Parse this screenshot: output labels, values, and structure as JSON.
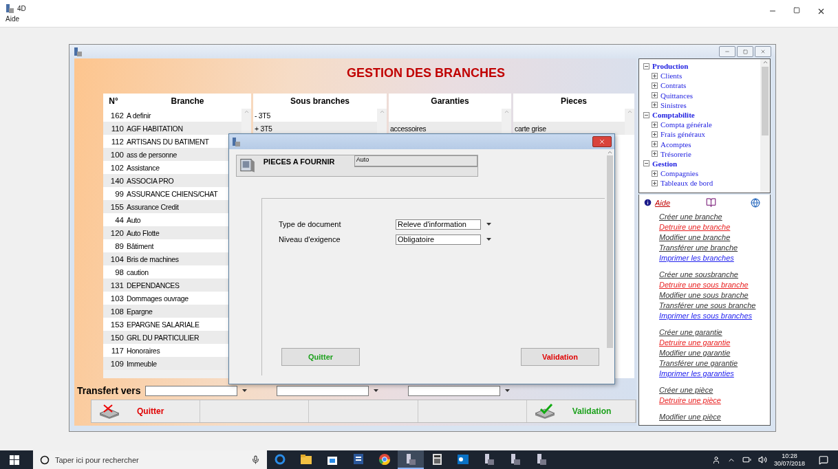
{
  "app": {
    "title": "4D",
    "menu": [
      "Aide"
    ]
  },
  "main_window": {
    "title": "GESTION DES BRANCHES",
    "columns": [
      "N°",
      "Branche",
      "Sous branches",
      "Garanties",
      "Pieces"
    ],
    "rows": [
      {
        "number": "162",
        "branche": "A definir",
        "sous_branche": "- 3T5"
      },
      {
        "number": "110",
        "branche": "AGF HABITATION",
        "sous_branche": "+ 3T5",
        "garantie": "accessoires",
        "piece": "carte grise"
      },
      {
        "number": "112",
        "branche": "ARTISANS DU BATIMENT"
      },
      {
        "number": "100",
        "branche": "ass de personne"
      },
      {
        "number": "102",
        "branche": "Assistance"
      },
      {
        "number": "140",
        "branche": "ASSOCIA PRO"
      },
      {
        "number": "99",
        "branche": "ASSURANCE CHIENS/CHAT"
      },
      {
        "number": "155",
        "branche": "Assurance Credit"
      },
      {
        "number": "44",
        "branche": "Auto"
      },
      {
        "number": "120",
        "branche": "Auto Flotte"
      },
      {
        "number": "89",
        "branche": "Bâtiment"
      },
      {
        "number": "104",
        "branche": "Bris de machines"
      },
      {
        "number": "98",
        "branche": "caution"
      },
      {
        "number": "131",
        "branche": "DEPENDANCES"
      },
      {
        "number": "103",
        "branche": "Dommages ouvrage"
      },
      {
        "number": "108",
        "branche": "Epargne"
      },
      {
        "number": "153",
        "branche": "EPARGNE SALARIALE"
      },
      {
        "number": "150",
        "branche": "GRL DU PARTICULIER"
      },
      {
        "number": "117",
        "branche": "Honoraires"
      },
      {
        "number": "109",
        "branche": "Immeuble"
      }
    ],
    "transfer_label": "Transfert vers",
    "buttons": [
      {
        "label": "Quitter",
        "kind": "quit"
      },
      {
        "label": "Validation",
        "kind": "validate"
      }
    ]
  },
  "navigator": [
    {
      "label": "Production",
      "expanded": true,
      "children": [
        {
          "label": "Clients",
          "expanded": false
        },
        {
          "label": "Contrats",
          "expanded": false
        },
        {
          "label": "Quittances",
          "expanded": false
        },
        {
          "label": "Sinistres",
          "expanded": false
        }
      ]
    },
    {
      "label": "Comptabilite",
      "expanded": true,
      "children": [
        {
          "label": "Compta générale",
          "expanded": false
        },
        {
          "label": "Frais généraux",
          "expanded": false
        },
        {
          "label": "Acomptes",
          "expanded": false
        },
        {
          "label": "Trésorerie",
          "expanded": false
        }
      ]
    },
    {
      "label": "Gestion",
      "expanded": true,
      "children": [
        {
          "label": "Compagnies",
          "expanded": false
        },
        {
          "label": "Tableaux de bord",
          "expanded": false
        }
      ]
    }
  ],
  "help": {
    "title": "Aide",
    "groups": [
      [
        {
          "label": "Créer une branche",
          "kind": "neutral"
        },
        {
          "label": "Detruire une branche",
          "kind": "danger"
        },
        {
          "label": "Modifier une branche",
          "kind": "neutral"
        },
        {
          "label": "Transférer une branche",
          "kind": "neutral"
        },
        {
          "label": "Imprimer les branches",
          "kind": "print"
        }
      ],
      [
        {
          "label": "Créer une sousbranche",
          "kind": "neutral"
        },
        {
          "label": "Detruire une sous branche",
          "kind": "danger"
        },
        {
          "label": "Modifier une  sous branche",
          "kind": "neutral"
        },
        {
          "label": "Transférer une sous branche",
          "kind": "neutral"
        },
        {
          "label": "Imprimer les  sous branches",
          "kind": "print"
        }
      ],
      [
        {
          "label": "Créer une garantie",
          "kind": "neutral"
        },
        {
          "label": "Detruire une garantie",
          "kind": "danger"
        },
        {
          "label": "Modifier une  garantie",
          "kind": "neutral"
        },
        {
          "label": "Transférer une garantie",
          "kind": "neutral"
        },
        {
          "label": "Imprimer les  garanties",
          "kind": "print"
        }
      ],
      [
        {
          "label": "Créer une pièce",
          "kind": "neutral"
        },
        {
          "label": "Detruire une pièce",
          "kind": "danger"
        }
      ],
      [
        {
          "label": "Modifier une  pièce",
          "kind": "neutral"
        }
      ]
    ]
  },
  "dialog": {
    "title": "PIECES A FOURNIR",
    "value": "Auto",
    "fields": [
      {
        "label": "Type de document",
        "value": "Releve d'information"
      },
      {
        "label": "Niveau d'exigence",
        "value": "Obligatoire"
      }
    ],
    "buttons": [
      {
        "label": "Quitter",
        "kind": "quit"
      },
      {
        "label": "Validation",
        "kind": "validate"
      }
    ]
  },
  "taskbar": {
    "search_placeholder": "Taper ici pour rechercher",
    "apps": [
      {
        "kind": "browser",
        "selected": false
      },
      {
        "kind": "folder",
        "selected": false
      },
      {
        "kind": "store",
        "selected": false
      },
      {
        "kind": "word",
        "selected": false
      },
      {
        "kind": "chrome",
        "selected": false
      },
      {
        "kind": "app",
        "selected": true
      },
      {
        "kind": "calculator",
        "selected": false
      },
      {
        "kind": "mail",
        "selected": false
      },
      {
        "kind": "app",
        "selected": false
      },
      {
        "kind": "app",
        "selected": false
      },
      {
        "kind": "app",
        "selected": false
      }
    ],
    "time": "10:28",
    "date": "30/07/2018"
  }
}
